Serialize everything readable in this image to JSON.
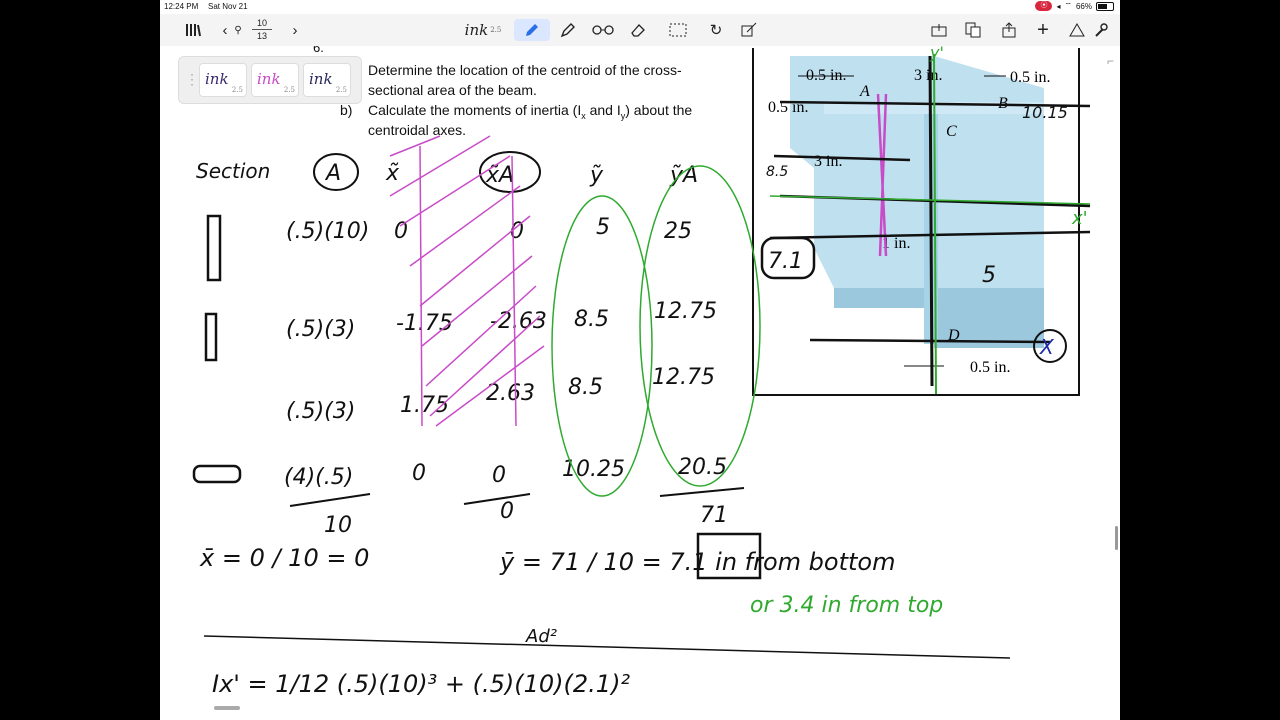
{
  "status": {
    "time": "12:24 PM",
    "date": "Sat Nov 21",
    "battery": "66%",
    "battery_level": 0.66
  },
  "toolbar": {
    "page_current": "10",
    "page_total": "13",
    "pen_size": "2.5",
    "icons": [
      "library-icon",
      "back-icon",
      "search-icon",
      "forward-icon",
      "pen-icon",
      "highlighter-icon",
      "lasso-icon",
      "eraser-icon",
      "selection-icon",
      "undo-icon",
      "shape-icon",
      "export-icon",
      "copy-icon",
      "share-icon",
      "add-page-icon",
      "more-icon",
      "settings-icon"
    ]
  },
  "palette": {
    "pens": [
      {
        "label": "ink",
        "size": "2.5",
        "color": "#3b2a6e"
      },
      {
        "label": "ink",
        "size": "2.5",
        "color": "#c84bc8"
      },
      {
        "label": "ink",
        "size": "2.5",
        "color": "#2b2a5e"
      }
    ]
  },
  "question": {
    "number": "6.",
    "part_a_line1": "Determine the location of the centroid of the cross-",
    "part_a_line2": "sectional area of the beam.",
    "part_b_marker": "b)",
    "part_b_line1": "Calculate the moments of inertia (I",
    "part_b_line2": "centroidal axes."
  },
  "figure": {
    "dims_top_left": "0.5 in.",
    "dims_top_mid": "3 in.",
    "dims_top_right": "0.5 in.",
    "dims_left": "0.5 in.",
    "dims_inner": "3 in.",
    "dims_web": "1 in.",
    "dims_bottom": "0.5 in.",
    "labels": [
      "A",
      "B",
      "C",
      "D"
    ]
  },
  "handwriting": {
    "headers": [
      "Section",
      "A",
      "x̃",
      "x̃A",
      "ỹ",
      "ỹA"
    ],
    "rows": [
      {
        "A": "(.5)(10)",
        "x": "0",
        "xA": "0",
        "y": "5",
        "yA": "25"
      },
      {
        "A": "(.5)(3)",
        "x": "-1.75",
        "xA": "-2.63",
        "y": "8.5",
        "yA": "12.75"
      },
      {
        "A": "(.5)(3)",
        "x": "1.75",
        "xA": "2.63",
        "y": "8.5",
        "yA": "12.75"
      },
      {
        "A": "(4)(.5)",
        "x": "0",
        "xA": "0",
        "y": "10.25",
        "yA": "20.5"
      }
    ],
    "sum_A": "10",
    "sum_xA": "0",
    "sum_yA": "71",
    "xbar": "x̄ = 0 / 10 = 0",
    "ybar": "ȳ = 71 / 10 = 7.1 in from bottom",
    "ybar_alt": "or 3.4 in from top",
    "ix_line": "Ix' = 1/12 (.5)(10)³ + (.5)(10)(2.1)²",
    "ad2": "Ad²",
    "fig_notes": [
      "10.15",
      "8.5",
      "7.1",
      "5",
      "x'",
      "y'"
    ]
  }
}
